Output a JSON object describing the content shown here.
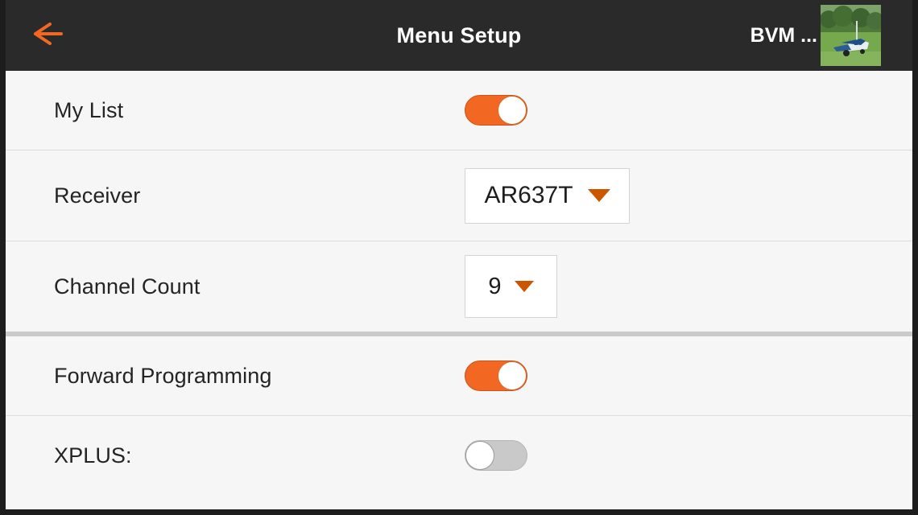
{
  "header": {
    "title": "Menu Setup",
    "model_name": "BVM ...",
    "back_icon": "back-arrow-icon",
    "thumbnail_icon": "model-photo-thumbnail",
    "bar_color": "#2b2a2a",
    "accent_color": "#f26722"
  },
  "theme": {
    "background": "#f6f6f6",
    "accent": "#f26722",
    "caret": "#cc5500",
    "toggle_off": "#c9c9c9",
    "separator_thin": "#dcdcdc",
    "separator_thick": "#cacaca",
    "bezel": "#1e1d1d"
  },
  "rows": [
    {
      "label": "My List",
      "control": "toggle",
      "state": "on"
    },
    {
      "label": "Receiver",
      "control": "dropdown",
      "value": "AR637T",
      "caret_icon": "chevron-down-icon"
    },
    {
      "label": "Channel Count",
      "control": "dropdown",
      "value": "9",
      "caret_icon": "chevron-down-icon"
    },
    {
      "label": "Forward Programming",
      "control": "toggle",
      "state": "on"
    },
    {
      "label": "XPLUS:",
      "control": "toggle",
      "state": "off"
    }
  ]
}
